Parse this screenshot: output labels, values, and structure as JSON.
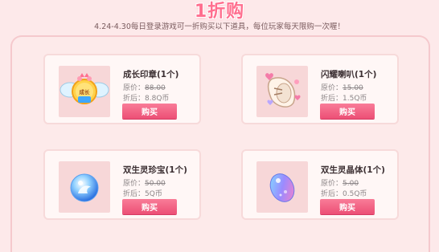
{
  "header": {
    "title": "1折购",
    "subtitle": "4.24-4.30每日登录游戏可一折购买以下道具，每位玩家每天限购一次喔！"
  },
  "items": [
    {
      "name": "成长印章(1个)",
      "orig_label": "原价：",
      "orig_price": "88.00",
      "discount_label": "折后：",
      "discount_price": "8.8Q币",
      "button": "购买",
      "icon_text": "成长"
    },
    {
      "name": "闪耀喇叭(1个)",
      "orig_label": "原价：",
      "orig_price": "15.00",
      "discount_label": "折后：",
      "discount_price": "1.5Q币",
      "button": "购买"
    },
    {
      "name": "双生灵珍宝(1个)",
      "orig_label": "原价：",
      "orig_price": "50.00",
      "discount_label": "折后：",
      "discount_price": "5Q币",
      "button": "购买"
    },
    {
      "name": "双生灵晶体(1个)",
      "orig_label": "原价：",
      "orig_price": "5.00",
      "discount_label": "折后：",
      "discount_price": "0.5Q币",
      "button": "购买"
    }
  ],
  "colors": {
    "accent": "#ff6f8f",
    "button": "#ec4f75",
    "background": "#fde9ea"
  }
}
